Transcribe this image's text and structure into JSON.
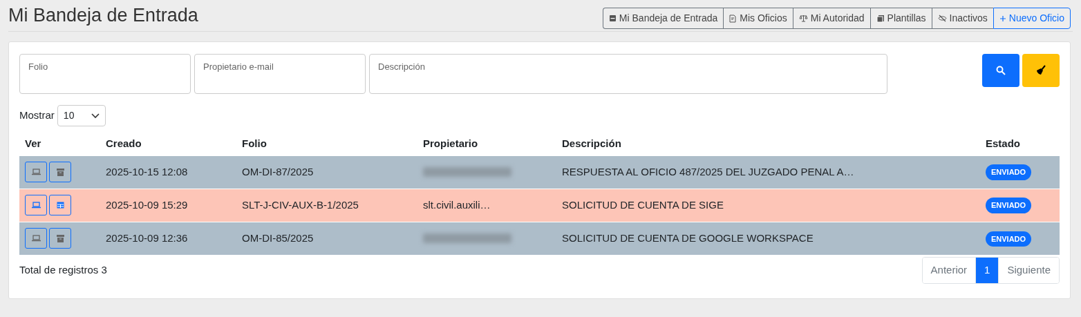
{
  "page_title": "Mi Bandeja de Entrada",
  "nav_buttons": [
    {
      "label": "Mi Bandeja de Entrada",
      "kind": "inbox"
    },
    {
      "label": "Mis Oficios",
      "kind": "doc"
    },
    {
      "label": "Mi Autoridad",
      "kind": "scale"
    },
    {
      "label": "Plantillas",
      "kind": "copies"
    },
    {
      "label": "Inactivos",
      "kind": "eye-off"
    },
    {
      "label": "Nuevo Oficio",
      "kind": "plus"
    }
  ],
  "filters": [
    {
      "placeholder": "Folio"
    },
    {
      "placeholder": "Propietario e-mail"
    },
    {
      "placeholder": "Descripción"
    }
  ],
  "page_size": {
    "label": "Mostrar",
    "value": "10"
  },
  "table": {
    "columns": [
      "Ver",
      "Creado",
      "Folio",
      "Propietario",
      "Descripción",
      "Estado"
    ],
    "rows": [
      {
        "kind": "muted",
        "created": "2025-10-15 12:08",
        "folio": "OM-DI-87/2025",
        "owner_blurred": true,
        "description": "RESPUESTA AL OFICIO 487/2025 DEL JUZGADO PENAL A…",
        "status": "ENVIADO"
      },
      {
        "kind": "highlight",
        "created": "2025-10-09 15:29",
        "folio": "SLT-J-CIV-AUX-B-1/2025",
        "owner": "slt.civil.auxili…",
        "owner_blurred": false,
        "description": "SOLICITUD DE CUENTA DE SIGE",
        "status": "ENVIADO"
      },
      {
        "kind": "muted",
        "created": "2025-10-09 12:36",
        "folio": "OM-DI-85/2025",
        "owner_blurred": true,
        "description": "SOLICITUD DE CUENTA DE GOOGLE WORKSPACE",
        "status": "ENVIADO"
      }
    ]
  },
  "total": "Total de registros 3",
  "pagination": [
    {
      "label": "Anterior",
      "selected": false
    },
    {
      "label": "1",
      "selected": true
    },
    {
      "label": "Siguiente",
      "selected": false
    }
  ]
}
